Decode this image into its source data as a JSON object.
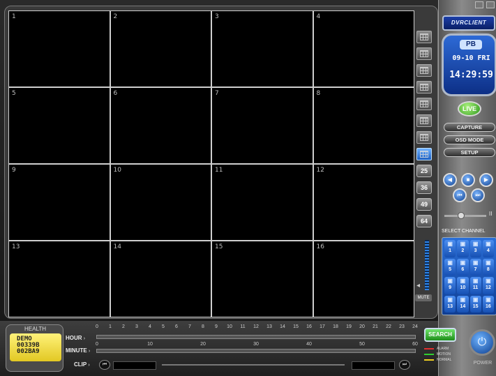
{
  "app": {
    "brand": "DVRCLIENT"
  },
  "window": {
    "min": "",
    "close": ""
  },
  "cameras": [
    {
      "num": "1"
    },
    {
      "num": "2"
    },
    {
      "num": "3"
    },
    {
      "num": "4"
    },
    {
      "num": "5"
    },
    {
      "num": "6"
    },
    {
      "num": "7"
    },
    {
      "num": "8"
    },
    {
      "num": "9"
    },
    {
      "num": "10"
    },
    {
      "num": "11"
    },
    {
      "num": "12"
    },
    {
      "num": "13"
    },
    {
      "num": "14"
    },
    {
      "num": "15"
    },
    {
      "num": "16"
    }
  ],
  "layouts": {
    "numbered": [
      "25",
      "36",
      "49",
      "64"
    ],
    "active_index": 7
  },
  "audio": {
    "mute": "MUTE",
    "volume_level": 0.6
  },
  "status": {
    "mode": "PB",
    "date": "09-10 FRI",
    "time": "14:29:59"
  },
  "controls": {
    "live": "LIVE",
    "capture": "CAPTURE",
    "osd_mode": "OSD MODE",
    "setup": "SETUP"
  },
  "ptz": {
    "prev": "◀",
    "stop": "■",
    "next": "▶",
    "first": "⏮",
    "last": "⏭"
  },
  "playback_speed": {
    "pause": "II"
  },
  "select_channel": {
    "label": "SELECT CHANNEL",
    "channels": [
      "1",
      "2",
      "3",
      "4",
      "5",
      "6",
      "7",
      "8",
      "9",
      "10",
      "11",
      "12",
      "13",
      "14",
      "15",
      "16"
    ]
  },
  "health": {
    "label": "HEALTH",
    "lines": [
      "DEMO",
      "00339B",
      "002BA9"
    ]
  },
  "timeline": {
    "hour_label": "HOUR",
    "minute_label": "MINUTE",
    "clip_label": "CLIP",
    "hours": [
      "0",
      "1",
      "2",
      "3",
      "4",
      "5",
      "6",
      "7",
      "8",
      "9",
      "10",
      "11",
      "12",
      "13",
      "14",
      "15",
      "16",
      "17",
      "18",
      "19",
      "20",
      "21",
      "22",
      "23",
      "24"
    ],
    "minutes": [
      "0",
      "10",
      "20",
      "30",
      "40",
      "50",
      "60"
    ]
  },
  "search": {
    "label": "SEARCH"
  },
  "legend": [
    {
      "label": "ALARM",
      "color": "#e03030"
    },
    {
      "label": "MOTION",
      "color": "#30d030"
    },
    {
      "label": "NORMAL",
      "color": "#f0d020"
    }
  ],
  "power": {
    "label": "POWER"
  }
}
